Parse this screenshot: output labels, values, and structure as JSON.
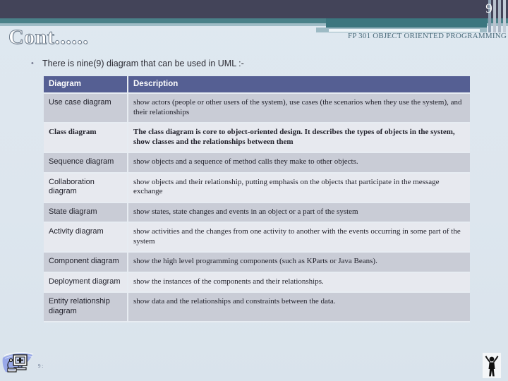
{
  "slide": {
    "page_number": "9",
    "title": "Cont......",
    "course_label": "FP 301 OBJECT ORIENTED PROGRAMMING",
    "bullet_marker": "•",
    "bullet_text": "There is nine(9) diagram that can be used in UML :-",
    "page_marker": "9 :",
    "colors": {
      "header_navy": "#434459",
      "header_teal": "#4a8189",
      "header_teal_dark": "#3b767f",
      "header_steel": "#9fbcc6",
      "table_header": "#555f93",
      "row_tone_a": "#c9ccd6",
      "row_tone_b": "#e7e9ef",
      "slide_background": "#dee7ef",
      "course_label_text": "#4a6b7a"
    }
  },
  "table": {
    "columns": [
      "Diagram",
      "Description"
    ],
    "rows": [
      {
        "name": "Use case diagram",
        "description": "show actors (people or other users of the system), use cases (the scenarios when they use the system), and their relationships",
        "emphasis": false
      },
      {
        "name": "Class diagram",
        "description": "The class diagram is core to object-oriented design.  It describes the types of objects in the system, show classes and the relationships between them",
        "emphasis": true
      },
      {
        "name": "Sequence diagram",
        "description": "show objects and a sequence of method calls they make to other objects.",
        "emphasis": false
      },
      {
        "name": "Collaboration diagram",
        "description": "show objects and their relationship, putting emphasis on the objects that participate in the message exchange",
        "emphasis": false
      },
      {
        "name": "State diagram",
        "description": "show states, state changes and events in an object or a part of the system",
        "emphasis": false
      },
      {
        "name": "Activity diagram",
        "description": "show activities and the changes from one activity to another with the events occurring in some part of the system",
        "emphasis": false
      },
      {
        "name": "Component diagram",
        "description": "show the high level programming components (such as KParts or Java Beans).",
        "emphasis": false
      },
      {
        "name": "Deployment diagram",
        "description": "show the instances of the components and their relationships.",
        "emphasis": false
      },
      {
        "name": "Entity relationship diagram",
        "description": "show data and the relationships and constraints between the data.",
        "emphasis": false
      }
    ]
  },
  "decor": {
    "computer_icon_name": "computer-clipart",
    "cheer_icon_name": "cheering-person-clipart"
  }
}
